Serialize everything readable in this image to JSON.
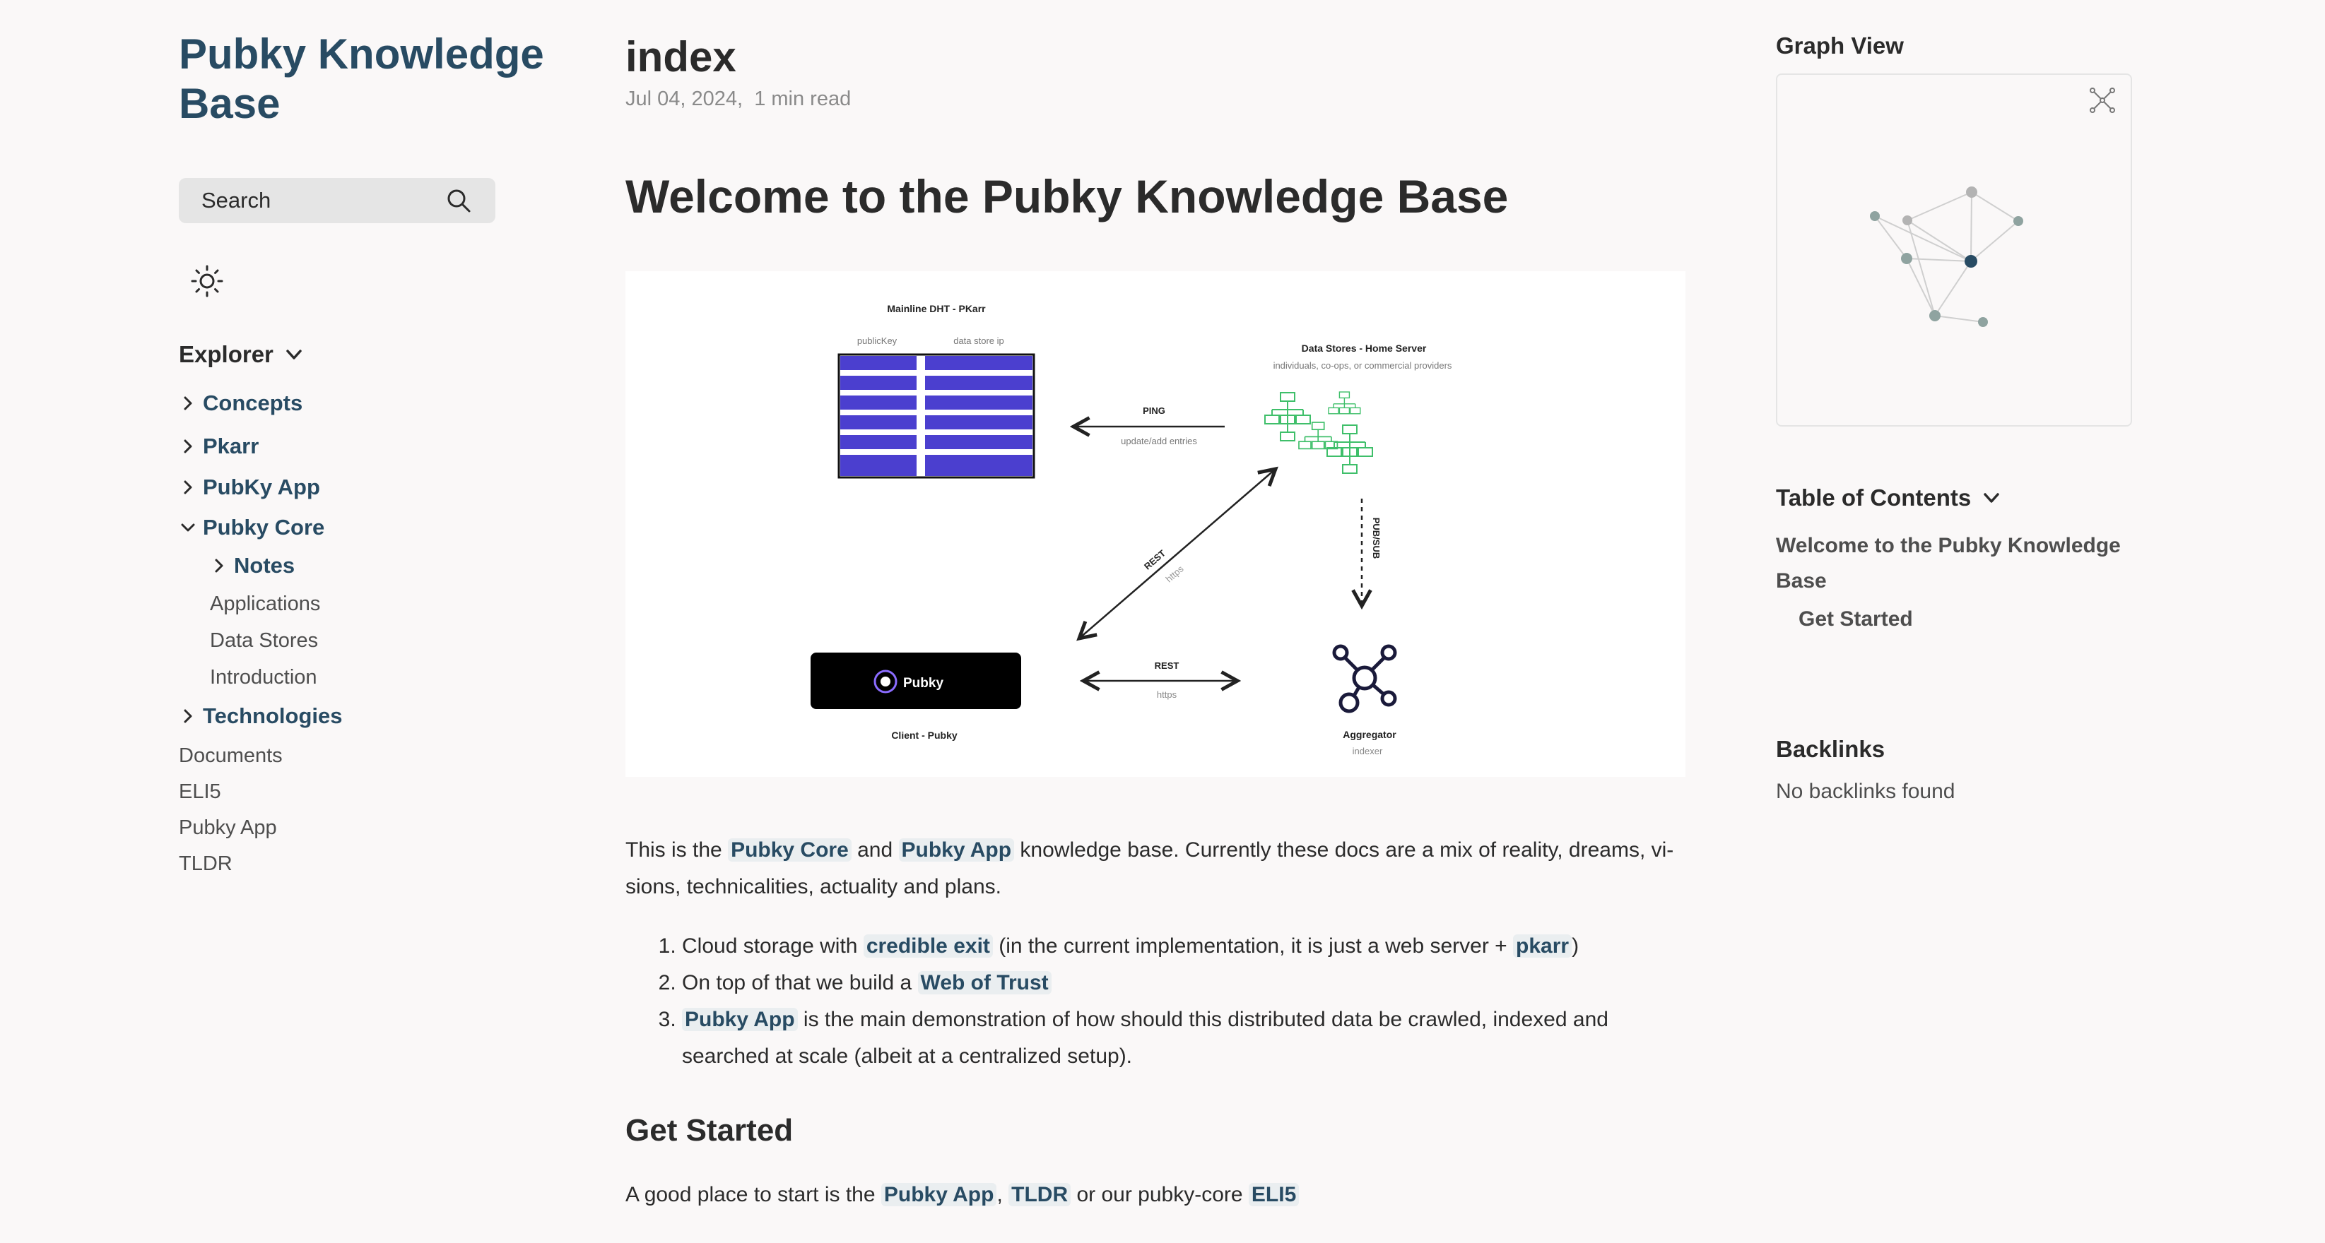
{
  "site": {
    "title": "Pubky Knowledge Base"
  },
  "search": {
    "label": "Search"
  },
  "explorer": {
    "title": "Explorer",
    "items": [
      {
        "label": "Concepts"
      },
      {
        "label": "Pkarr"
      },
      {
        "label": "PubKy App"
      },
      {
        "label": "Pubky Core"
      },
      {
        "label": "Notes"
      },
      {
        "label": "Applications"
      },
      {
        "label": "Data Stores"
      },
      {
        "label": "Introduction"
      },
      {
        "label": "Technologies"
      },
      {
        "label": "Documents"
      },
      {
        "label": "ELI5"
      },
      {
        "label": "Pubky App"
      },
      {
        "label": "TLDR"
      }
    ]
  },
  "article": {
    "title": "index",
    "date": "Jul 04, 2024",
    "read_time": "1 min read",
    "heading": "Welcome to the Pubky Knowledge Base",
    "intro": {
      "t1": "This is the ",
      "l1": "Pubky Core",
      "t2": " and ",
      "l2": "Pubky App",
      "t3": " knowledge base. Currently these docs are a mix of reality, dreams, vi-sions, technicalities, actuality and plans."
    },
    "list": [
      {
        "t1": "Cloud storage with ",
        "l1": "credible exit",
        "t2": " (in the current implementation, it is just a web server + ",
        "l2": "pkarr",
        "t3": ")"
      },
      {
        "t1": "On top of that we build a ",
        "l1": "Web of Trust"
      },
      {
        "l1": "Pubky App",
        "t1": " is the main demonstration of how should this distributed data be crawled, indexed and searched at scale (albeit at a centralized setup)."
      }
    ],
    "get_started": {
      "heading": "Get Started",
      "t1": "A good place to start is the ",
      "l1": "Pubky App",
      "t2": ", ",
      "l2": "TLDR",
      "t3": " or our pubky-core ",
      "l3": "ELI5"
    }
  },
  "diagram": {
    "dht_title": "Mainline DHT - PKarr",
    "col1": "publicKey",
    "col2": "data store ip",
    "stores_title": "Data Stores - Home Server",
    "stores_sub": "individuals, co-ops, or commercial providers",
    "ping": "PING",
    "ping_sub": "update/add entries",
    "rest_diag": "REST",
    "https_diag": "https",
    "pubsub": "PUB/SUB",
    "rest_h": "REST",
    "https_h": "https",
    "client_btn": "Pubky",
    "client_label": "Client - Pubky",
    "agg_label": "Aggregator",
    "agg_sub": "indexer"
  },
  "right": {
    "graph_title": "Graph View",
    "toc_title": "Table of Contents",
    "toc_items": [
      "Welcome to the Pubky Knowledge Base",
      "Get Started"
    ],
    "backlinks_title": "Backlinks",
    "backlinks_empty": "No backlinks found"
  },
  "colors": {
    "accent": "#284b63",
    "dht_fill": "#4b3fcf",
    "store_green": "#3fbf6a"
  }
}
